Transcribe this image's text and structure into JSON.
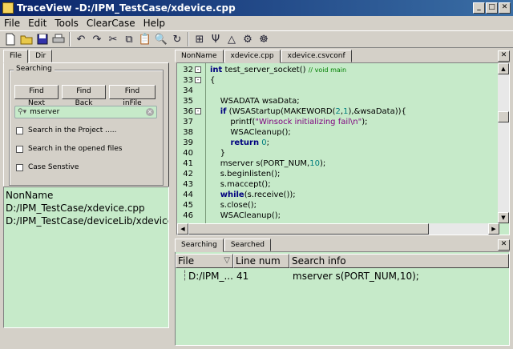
{
  "window": {
    "title": "TraceView -D:/IPM_TestCase/xdevice.cpp",
    "min": "_",
    "max": "□",
    "close": "✕"
  },
  "menu": [
    "File",
    "Edit",
    "Tools",
    "ClearCase",
    "Help"
  ],
  "toolbar_icons": [
    "new-file-icon",
    "open-folder-icon",
    "save-icon",
    "print-icon",
    "undo-icon",
    "redo-icon",
    "cut-icon",
    "copy-icon",
    "paste-icon",
    "find-icon",
    "refresh-icon",
    "tree-icon",
    "tower-icon",
    "triangle-icon",
    "flow-icon",
    "shell-icon"
  ],
  "left": {
    "tabs": [
      "File",
      "Dir"
    ],
    "group_title": "Searching",
    "buttons": [
      "Find Next",
      "Find Back",
      "Find inFile"
    ],
    "search_value": "mserver",
    "search_icon": "magnifier-icon",
    "checks": [
      "Search in the Project .....",
      "Search in the opened files",
      "Case Senstive"
    ],
    "files": [
      "NonName",
      "D:/IPM_TestCase/xdevice.cpp",
      "D:/IPM_TestCase/deviceLib/xdevice.c"
    ]
  },
  "editor": {
    "tabs": [
      "NonName",
      "xdevice.cpp",
      "xdevice.csvconf"
    ],
    "lines": [
      {
        "n": "32",
        "fold": "-",
        "html": "<span class='kw'>int</span> test_server_socket() <span class='cmt'>// void main</span>"
      },
      {
        "n": "33",
        "fold": "-",
        "html": "{"
      },
      {
        "n": "34",
        "html": ""
      },
      {
        "n": "35",
        "html": "    WSADATA wsaData;"
      },
      {
        "n": "36",
        "fold": "-",
        "html": "    <span class='kw'>if</span> (WSAStartup(MAKEWORD(<span class='num'>2</span>,<span class='num'>1</span>),&amp;wsaData)){"
      },
      {
        "n": "37",
        "html": "        printf(<span class='str'>\"Winsock initializing fail\\n\"</span>);"
      },
      {
        "n": "38",
        "html": "        WSACleanup();"
      },
      {
        "n": "39",
        "html": "        <span class='kw'>return</span> <span class='num'>0</span>;"
      },
      {
        "n": "40",
        "html": "    }"
      },
      {
        "n": "41",
        "html": "    mserver s(PORT_NUM,<span class='num'>10</span>);"
      },
      {
        "n": "42",
        "html": "    s.beginlisten();"
      },
      {
        "n": "43",
        "html": "    s.maccept();"
      },
      {
        "n": "44",
        "html": "    <span class='kw'>while</span>(s.receive());"
      },
      {
        "n": "45",
        "html": "    s.close();"
      },
      {
        "n": "46",
        "html": "    WSACleanup();"
      }
    ]
  },
  "bottom": {
    "tabs": [
      "Searching",
      "Searched"
    ],
    "headers": [
      "File",
      "Line num",
      "Search info"
    ],
    "row": {
      "file": "D:/IPM_...",
      "line": "41",
      "info": "mserver s(PORT_NUM,10);"
    }
  }
}
